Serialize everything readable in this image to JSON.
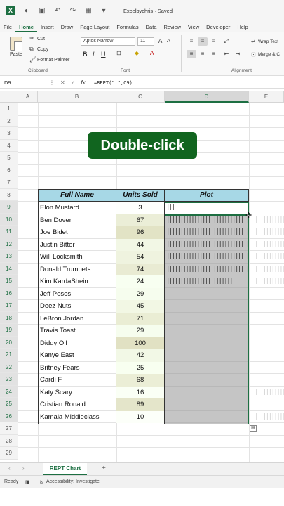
{
  "titlebar": {
    "app_icon": "excel-logo",
    "title": "Excelbychris · Saved"
  },
  "menu": [
    "File",
    "Home",
    "Insert",
    "Draw",
    "Page Layout",
    "Formulas",
    "Data",
    "Review",
    "View",
    "Developer",
    "Help"
  ],
  "menu_active": "Home",
  "ribbon": {
    "paste": "Paste",
    "cut": "Cut",
    "copy": "Copy",
    "format_painter": "Format Painter",
    "clipboard_label": "Clipboard",
    "font_name": "Aptos Narrow",
    "font_size": "11",
    "bold": "B",
    "italic": "I",
    "underline": "U",
    "grow_font": "A",
    "shrink_font": "A",
    "font_label": "Font",
    "wrap_text": "Wrap Text",
    "merge_center": "Merge & C",
    "alignment_label": "Alignment"
  },
  "formula_bar": {
    "name_box": "D9",
    "fx": "fx",
    "formula": "=REPT(\"|\",C9)"
  },
  "columns": [
    "A",
    "B",
    "C",
    "D",
    "E"
  ],
  "rows": [
    1,
    2,
    3,
    4,
    5,
    6,
    7,
    8,
    9,
    10,
    11,
    12,
    13,
    14,
    15,
    16,
    17,
    18,
    19,
    20,
    21,
    22,
    23,
    24,
    25,
    26,
    27,
    28,
    29
  ],
  "callout": "Double-click",
  "table": {
    "headers": [
      "Full Name",
      "Units Sold",
      "Plot"
    ],
    "rows": [
      {
        "name": "Elon Mustard",
        "units": "3"
      },
      {
        "name": "Ben Dover",
        "units": "67"
      },
      {
        "name": "Joe Bidet",
        "units": "96"
      },
      {
        "name": "Justin Bitter",
        "units": "44"
      },
      {
        "name": "Will Locksmith",
        "units": "54"
      },
      {
        "name": "Donald Trumpets",
        "units": "74"
      },
      {
        "name": "Kim KardaShein",
        "units": "24"
      },
      {
        "name": "Jeff Pesos",
        "units": "29"
      },
      {
        "name": "Deez Nuts",
        "units": "45"
      },
      {
        "name": "LeBron Jordan",
        "units": "71"
      },
      {
        "name": "Travis Toast",
        "units": "29"
      },
      {
        "name": "Diddy Oil",
        "units": "100"
      },
      {
        "name": "Kanye East",
        "units": "42"
      },
      {
        "name": "Britney Fears",
        "units": "25"
      },
      {
        "name": "Cardi F",
        "units": "68"
      },
      {
        "name": "Katy Scary",
        "units": "16"
      },
      {
        "name": "Cristian Ronald",
        "units": "89"
      },
      {
        "name": "Kamala Middleclass",
        "units": "10"
      }
    ],
    "first_plot_value": "|||"
  },
  "sheet_tab": "REPT Chart",
  "status": {
    "ready": "Ready",
    "accessibility": "Accessibility: Investigate"
  },
  "colors": {
    "excel_green": "#1d6f42",
    "header_fill": "#a7d8e6",
    "callout_fill": "#11651f"
  }
}
